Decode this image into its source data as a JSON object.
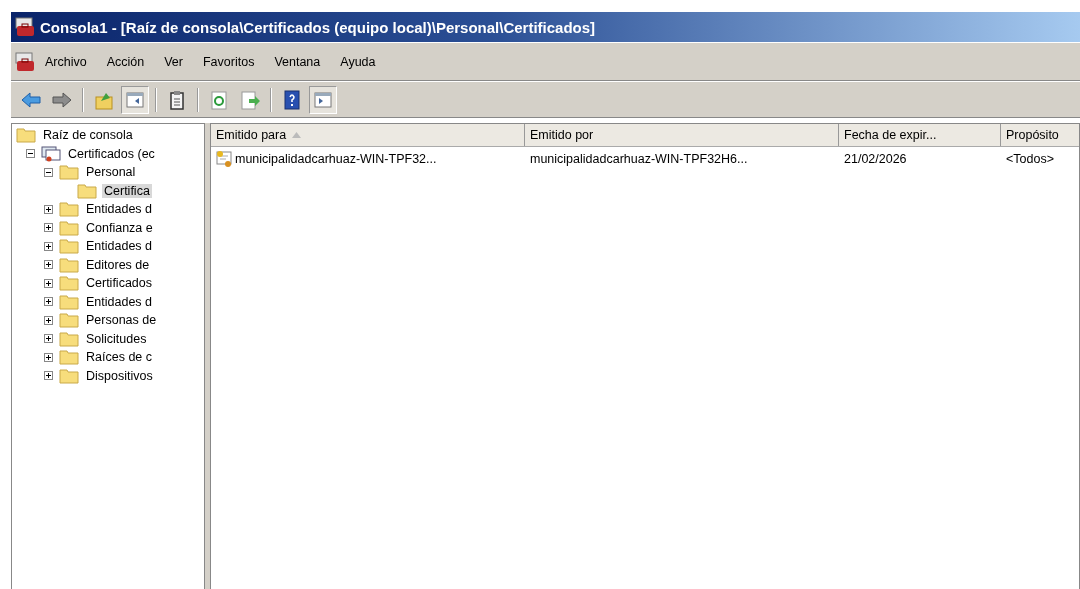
{
  "window": {
    "title": "Consola1 - [Raíz de consola\\Certificados (equipo local)\\Personal\\Certificados]"
  },
  "menu": [
    "Archivo",
    "Acción",
    "Ver",
    "Favoritos",
    "Ventana",
    "Ayuda"
  ],
  "toolbar": [
    {
      "kind": "back",
      "pressed": false
    },
    {
      "kind": "forward",
      "pressed": false
    },
    {
      "kind": "sep"
    },
    {
      "kind": "up",
      "pressed": false
    },
    {
      "kind": "tree",
      "pressed": true
    },
    {
      "kind": "sep"
    },
    {
      "kind": "properties",
      "pressed": false
    },
    {
      "kind": "sep"
    },
    {
      "kind": "refresh",
      "pressed": false
    },
    {
      "kind": "export",
      "pressed": false
    },
    {
      "kind": "sep"
    },
    {
      "kind": "help",
      "pressed": false
    },
    {
      "kind": "actionpane",
      "pressed": true
    }
  ],
  "tree": [
    {
      "label": "Raíz de consola",
      "kind": "folder",
      "selected": false,
      "children": [
        {
          "label": "Certificados (ec",
          "kind": "store",
          "selected": false,
          "expanded": true,
          "children": [
            {
              "label": "Personal",
              "kind": "folder",
              "selected": false,
              "expanded": true,
              "children": [
                {
                  "label": "Certifica",
                  "kind": "folder",
                  "selected": true
                }
              ]
            },
            {
              "label": "Entidades d",
              "kind": "folder",
              "selected": false,
              "expanded": false
            },
            {
              "label": "Confianza e",
              "kind": "folder",
              "selected": false,
              "expanded": false
            },
            {
              "label": "Entidades d",
              "kind": "folder",
              "selected": false,
              "expanded": false
            },
            {
              "label": "Editores de",
              "kind": "folder",
              "selected": false,
              "expanded": false
            },
            {
              "label": "Certificados",
              "kind": "folder",
              "selected": false,
              "expanded": false
            },
            {
              "label": "Entidades d",
              "kind": "folder",
              "selected": false,
              "expanded": false
            },
            {
              "label": "Personas de",
              "kind": "folder",
              "selected": false,
              "expanded": false
            },
            {
              "label": "Solicitudes",
              "kind": "folder",
              "selected": false,
              "expanded": false
            },
            {
              "label": "Raíces de c",
              "kind": "folder",
              "selected": false,
              "expanded": false
            },
            {
              "label": "Dispositivos",
              "kind": "folder",
              "selected": false,
              "expanded": false
            }
          ]
        }
      ]
    }
  ],
  "table": {
    "columns": [
      {
        "label": "Emitido para",
        "sorted": true
      },
      {
        "label": "Emitido por",
        "sorted": false
      },
      {
        "label": "Fecha de expir...",
        "sorted": false
      },
      {
        "label": "Propósito",
        "sorted": false
      }
    ],
    "rows": [
      {
        "selected": false,
        "cells": [
          "municipalidadcarhuaz-WIN-TPF32...",
          "municipalidadcarhuaz-WIN-TPF32H6...",
          "21/02/2026",
          "<Todos>"
        ]
      }
    ]
  }
}
